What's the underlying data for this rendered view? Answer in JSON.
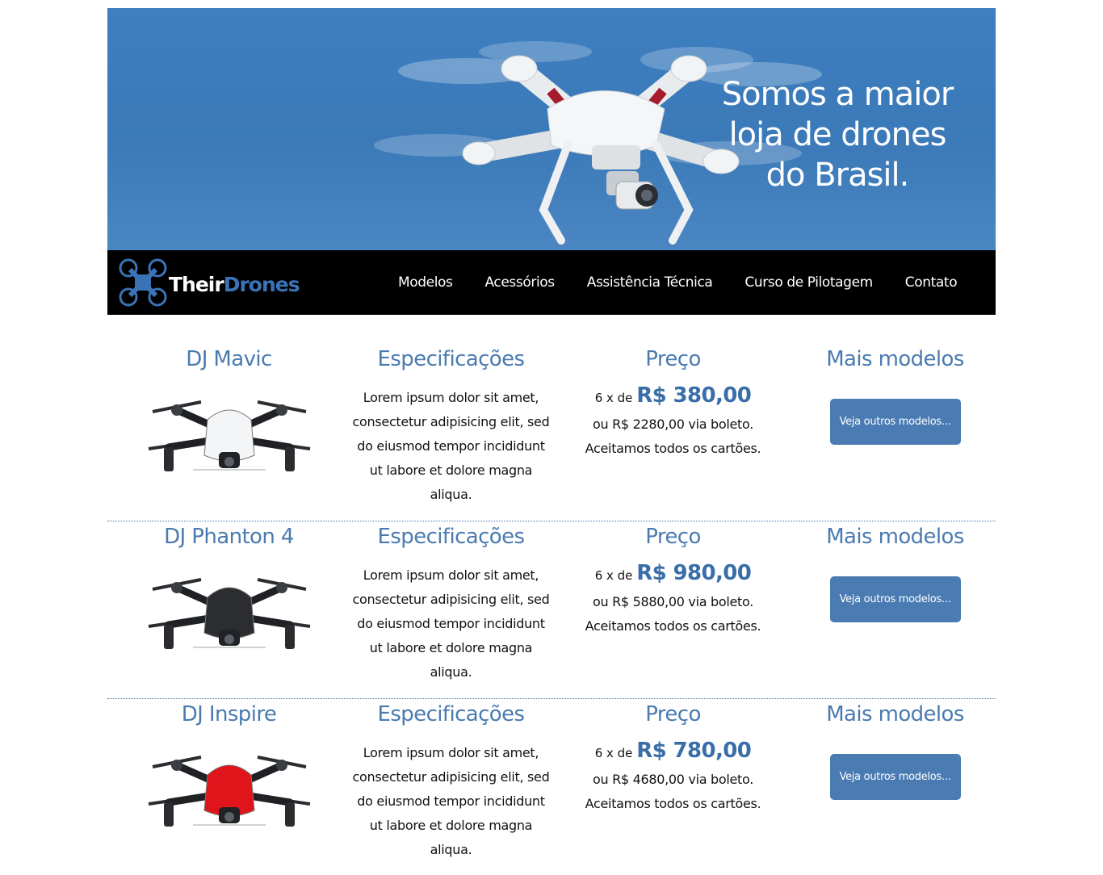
{
  "hero": {
    "headline_lines": [
      "Somos a maior",
      "loja de drones",
      "do Brasil."
    ]
  },
  "brand": {
    "name_part1": "Their",
    "name_part2": "Drones",
    "colors": {
      "nav_bg": "#000000",
      "accent": "#3a73b6",
      "hero_sky": "#3e7fc0",
      "button": "#4a7bb2"
    }
  },
  "nav": {
    "items": [
      "Modelos",
      "Acessórios",
      "Assistência Técnica",
      "Curso de Pilotagem",
      "Contato"
    ]
  },
  "products": [
    {
      "name": "DJ Mavic",
      "spec_heading": "Especificações",
      "spec_text": "Lorem ipsum dolor sit amet, consectetur adipisicing elit, sed do eiusmod tempor incididunt ut labore et dolore magna aliqua.",
      "price_heading": "Preço",
      "installments": "6 x de",
      "installment_value": "R$ 380,00",
      "boleto": "ou R$ 2280,00 via boleto.",
      "cards": "Aceitamos todos os cartões.",
      "more_heading": "Mais modelos",
      "button_label": "Veja outros modelos...",
      "drone_color": "#f4f5f6"
    },
    {
      "name": "DJ Phanton 4",
      "spec_heading": "Especificações",
      "spec_text": "Lorem ipsum dolor sit amet, consectetur adipisicing elit, sed do eiusmod tempor incididunt ut labore et dolore magna aliqua.",
      "price_heading": "Preço",
      "installments": "6 x de",
      "installment_value": "R$ 980,00",
      "boleto": "ou R$ 5880,00 via boleto.",
      "cards": "Aceitamos todos os cartões.",
      "more_heading": "Mais modelos",
      "button_label": "Veja outros modelos...",
      "drone_color": "#2b2d31"
    },
    {
      "name": "DJ Inspire",
      "spec_heading": "Especificações",
      "spec_text": "Lorem ipsum dolor sit amet, consectetur adipisicing elit, sed do eiusmod tempor incididunt ut labore et dolore magna aliqua.",
      "price_heading": "Preço",
      "installments": "6 x de",
      "installment_value": "R$ 780,00",
      "boleto": "ou R$ 4680,00 via boleto.",
      "cards": "Aceitamos todos os cartões.",
      "more_heading": "Mais modelos",
      "button_label": "Veja outros modelos...",
      "drone_color": "#e0141b"
    }
  ]
}
